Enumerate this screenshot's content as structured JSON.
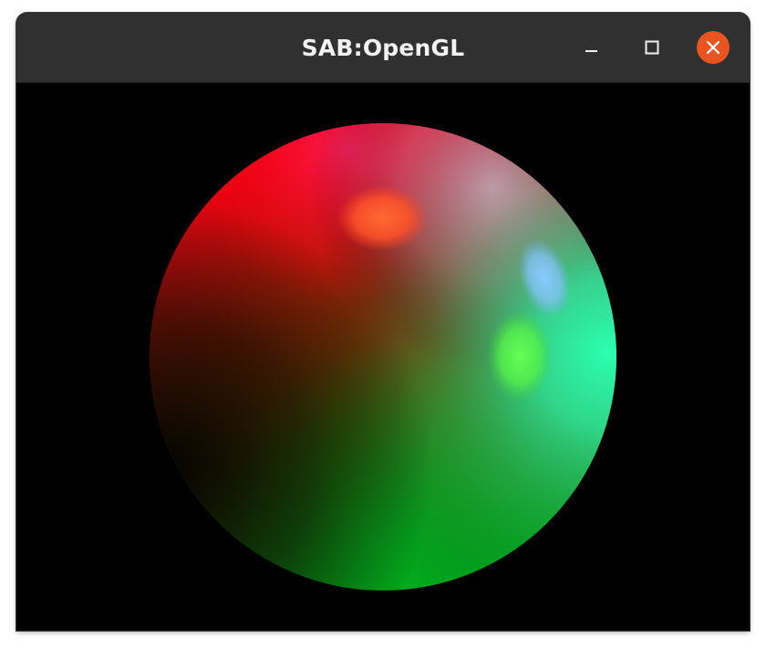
{
  "window": {
    "title": "SAB:OpenGL",
    "controls": {
      "minimize_icon": "minimize-icon",
      "maximize_icon": "maximize-icon",
      "close_icon": "close-icon",
      "close_color": "#e95420"
    }
  },
  "scene": {
    "background": "#000000",
    "object": "shaded-sphere",
    "lights": [
      {
        "name": "red-light",
        "color": "#ff0000"
      },
      {
        "name": "green-light",
        "color": "#00ff00"
      },
      {
        "name": "blue-light",
        "color": "#0000ff"
      }
    ]
  }
}
